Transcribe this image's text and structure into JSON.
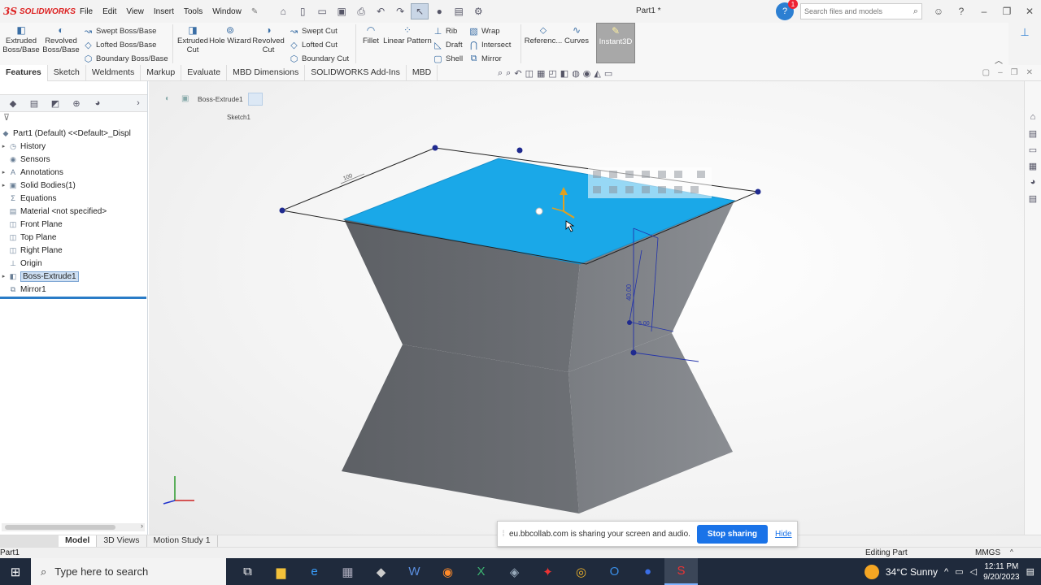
{
  "app": {
    "logo_text": "SOLIDWORKS",
    "menu": [
      "File",
      "Edit",
      "View",
      "Insert",
      "Tools",
      "Window"
    ],
    "document_title": "Part1 *",
    "search_placeholder": "Search files and models",
    "notification_count": "1"
  },
  "ribbon": {
    "extruded_boss": "Extruded Boss/Base",
    "revolved_boss": "Revolved Boss/Base",
    "swept_boss": "Swept Boss/Base",
    "lofted_boss": "Lofted Boss/Base",
    "boundary_boss": "Boundary Boss/Base",
    "extruded_cut": "Extruded Cut",
    "hole_wizard": "Hole Wizard",
    "revolved_cut": "Revolved Cut",
    "swept_cut": "Swept Cut",
    "lofted_cut": "Lofted Cut",
    "boundary_cut": "Boundary Cut",
    "fillet": "Fillet",
    "linear_pattern": "Linear Pattern",
    "rib": "Rib",
    "draft": "Draft",
    "shell": "Shell",
    "wrap": "Wrap",
    "intersect": "Intersect",
    "mirror": "Mirror",
    "reference": "Referenc...",
    "curves": "Curves",
    "instant3d": "Instant3D"
  },
  "tabs": [
    "Features",
    "Sketch",
    "Weldments",
    "Markup",
    "Evaluate",
    "MBD Dimensions",
    "SOLIDWORKS Add-Ins",
    "MBD"
  ],
  "feature_tree": {
    "root": "Part1 (Default) <<Default>_Displ",
    "items": [
      {
        "label": "History",
        "icon": "history-icon",
        "expand": true
      },
      {
        "label": "Sensors",
        "icon": "sensor-icon",
        "expand": false
      },
      {
        "label": "Annotations",
        "icon": "annotation-icon",
        "expand": true
      },
      {
        "label": "Solid Bodies(1)",
        "icon": "solid-bodies-icon",
        "expand": true
      },
      {
        "label": "Equations",
        "icon": "equation-icon",
        "expand": false
      },
      {
        "label": "Material <not specified>",
        "icon": "material-icon",
        "expand": false
      },
      {
        "label": "Front Plane",
        "icon": "plane-icon",
        "expand": false
      },
      {
        "label": "Top Plane",
        "icon": "plane-icon",
        "expand": false
      },
      {
        "label": "Right Plane",
        "icon": "plane-icon",
        "expand": false
      },
      {
        "label": "Origin",
        "icon": "origin-icon",
        "expand": false
      },
      {
        "label": "Boss-Extrude1",
        "icon": "extrude-icon",
        "expand": true,
        "selected": true
      },
      {
        "label": "Mirror1",
        "icon": "mirror-icon",
        "expand": false
      }
    ]
  },
  "graphics": {
    "breadcrumb_feature": "Boss-Extrude1",
    "breadcrumb_sketch": "Sketch1",
    "dimension_text": "100",
    "side_dimension": "40.00",
    "angle_dimension": "5.00",
    "top_face_color": "#1aa8e8",
    "body_color": "#6b6e73"
  },
  "model_tabs": [
    "Model",
    "3D Views",
    "Motion Study 1"
  ],
  "status": {
    "left": "Part1",
    "mode": "Editing Part",
    "units": "MMGS",
    "caret": "^"
  },
  "share": {
    "message": "eu.bbcollab.com is sharing your screen and audio.",
    "stop_label": "Stop sharing",
    "hide_label": "Hide"
  },
  "taskbar": {
    "search_placeholder": "Type here to search",
    "weather": "34°C  Sunny",
    "time": "12:11 PM",
    "date": "9/20/2023"
  }
}
